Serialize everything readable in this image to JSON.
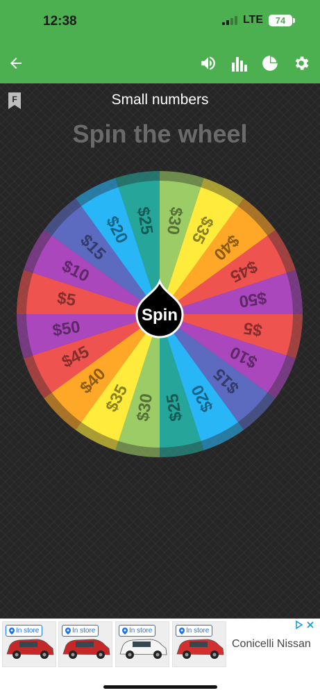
{
  "status_bar": {
    "time": "12:38",
    "network": "LTE",
    "battery": "74"
  },
  "app_bar": {
    "icons": [
      "back-arrow-icon",
      "volume-icon",
      "stats-bar-chart-icon",
      "pie-chart-icon",
      "settings-gear-icon"
    ]
  },
  "preset_name": "Small numbers",
  "wheel_title": "Spin the wheel",
  "spin_label": "Spin",
  "wheel_segments": [
    {
      "label": "$30",
      "color": "#9ccc65"
    },
    {
      "label": "$35",
      "color": "#ffeb3b"
    },
    {
      "label": "$40",
      "color": "#ffa726"
    },
    {
      "label": "$45",
      "color": "#ef5350"
    },
    {
      "label": "$50",
      "color": "#ab47bc"
    },
    {
      "label": "$5",
      "color": "#ef5350"
    },
    {
      "label": "$10",
      "color": "#ab47bc"
    },
    {
      "label": "$15",
      "color": "#5c6bc0"
    },
    {
      "label": "$20",
      "color": "#29b6f6"
    },
    {
      "label": "$25",
      "color": "#26a69a"
    },
    {
      "label": "$30",
      "color": "#9ccc65"
    },
    {
      "label": "$35",
      "color": "#ffeb3b"
    },
    {
      "label": "$40",
      "color": "#ffa726"
    },
    {
      "label": "$45",
      "color": "#ef5350"
    },
    {
      "label": "$50",
      "color": "#ab47bc"
    },
    {
      "label": "$5",
      "color": "#ef5350"
    },
    {
      "label": "$10",
      "color": "#ab47bc"
    },
    {
      "label": "$15",
      "color": "#5c6bc0"
    },
    {
      "label": "$20",
      "color": "#29b6f6"
    },
    {
      "label": "$25",
      "color": "#26a69a"
    }
  ],
  "ad": {
    "badges": [
      "In store",
      "In store",
      "In store",
      "In store"
    ],
    "car_colors": [
      "#c62828",
      "#c62828",
      "#f5f5f5",
      "#d32f2f"
    ],
    "advertiser": "Conicelli Nissan"
  },
  "colors": {
    "app_green": "#4caf50",
    "background": "#262626",
    "title_gray": "#6a6a6a"
  }
}
